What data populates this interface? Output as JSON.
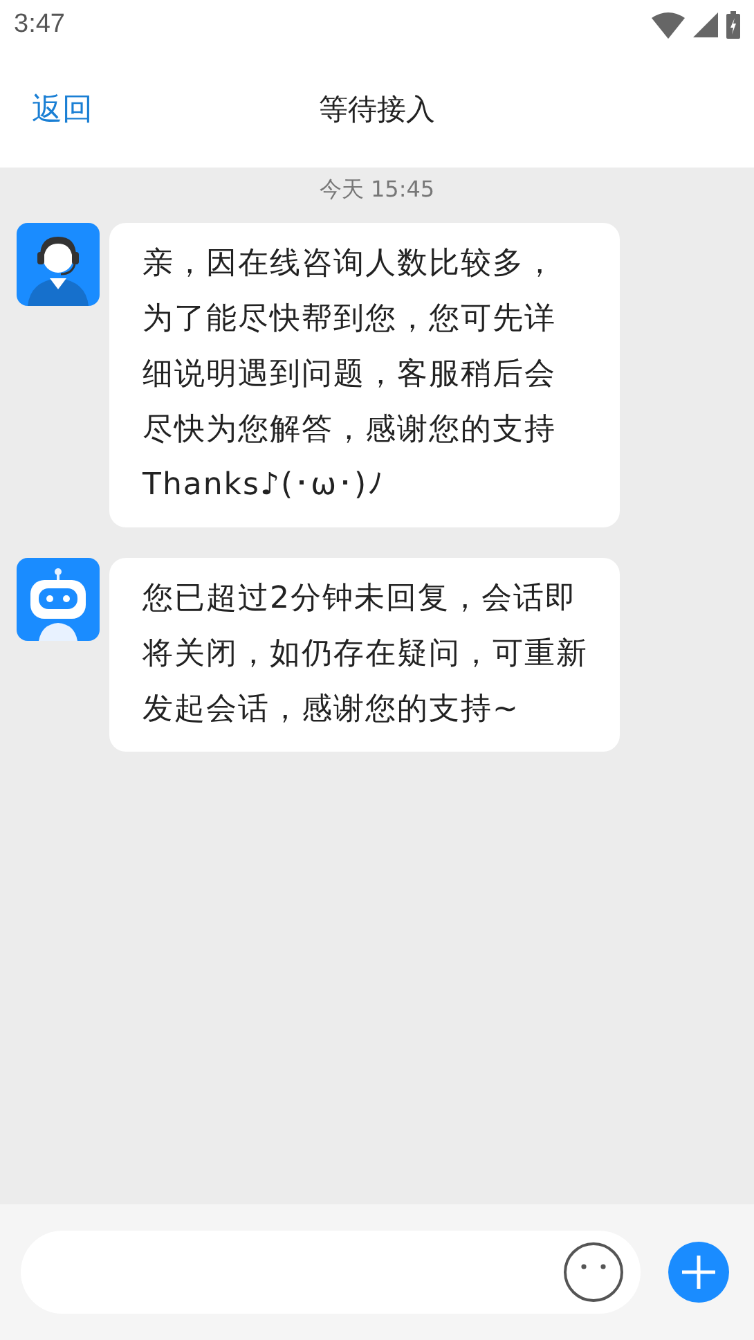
{
  "status_bar": {
    "time": "3:47"
  },
  "header": {
    "back": "返回",
    "title": "等待接入"
  },
  "chat": {
    "timestamp": "今天  15:45",
    "messages": [
      {
        "kind": "agent",
        "lines": [
          "亲，因在线咨询人数比较多，",
          "为了能尽快帮到您，您可先详",
          "细说明遇到问题，客服稍后会",
          "尽快为您解答，感谢您的支持",
          "Thanks♪(･ω･)ﾉ"
        ]
      },
      {
        "kind": "bot",
        "text": "您已超过2分钟未回复，会话即将关闭，如仍存在疑问，可重新发起会话，感谢您的支持~"
      }
    ]
  }
}
